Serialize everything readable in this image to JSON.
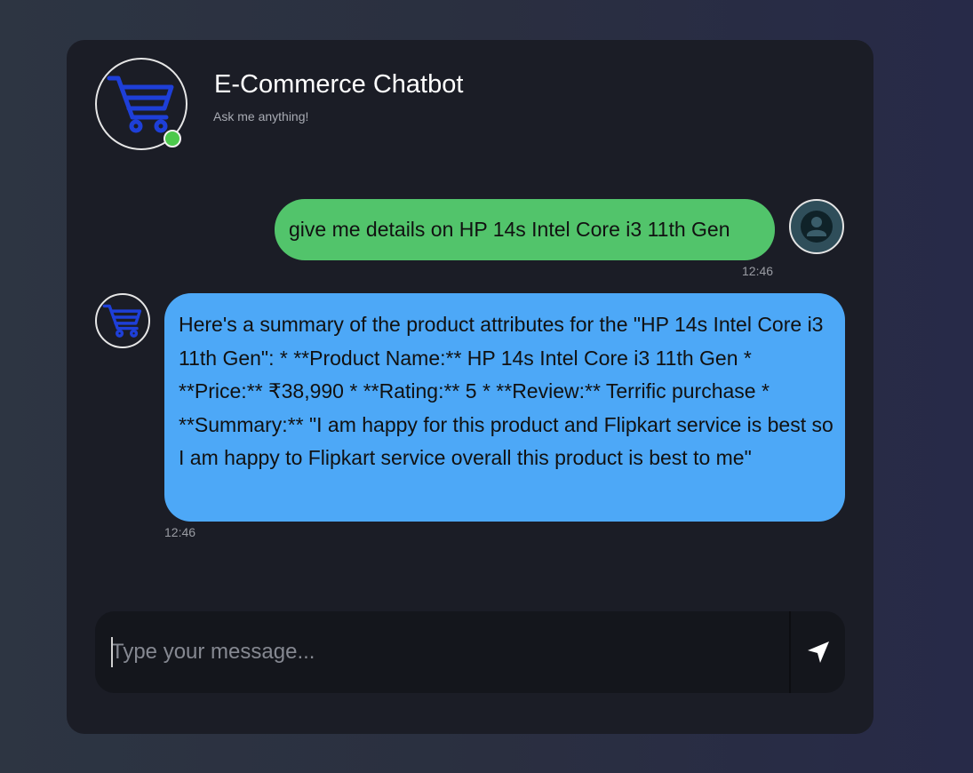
{
  "header": {
    "title": "E-Commerce Chatbot",
    "subtitle": "Ask me anything!",
    "avatar_icon": "shopping-cart-icon",
    "status": "online",
    "status_color": "#4cc94c"
  },
  "messages": [
    {
      "sender": "user",
      "text": "give me details on HP 14s Intel Core i3 11th Gen",
      "time": "12:46",
      "avatar_icon": "user-icon",
      "bubble_color": "#52c46b"
    },
    {
      "sender": "bot",
      "text": "Here's a summary of the product attributes for the \"HP 14s Intel Core i3 11th Gen\": * **Product Name:** HP 14s Intel Core i3 11th Gen * **Price:** ₹38,990 * **Rating:** 5 * **Review:** Terrific purchase * **Summary:** \"I am happy for this product and Flipkart service is best so I am happy to Flipkart service overall this product is best to me\"",
      "time": "12:46",
      "avatar_icon": "shopping-cart-icon",
      "bubble_color": "#4da8f7"
    }
  ],
  "composer": {
    "placeholder": "Type your message...",
    "value": "",
    "send_icon": "send-arrow-icon"
  },
  "colors": {
    "accent_cart": "#1e3fd8",
    "card_background": "#1b1d26"
  }
}
